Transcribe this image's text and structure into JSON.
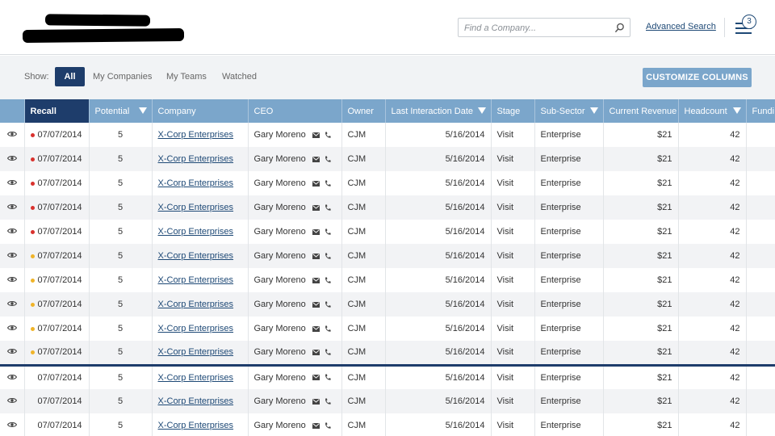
{
  "header": {
    "search_placeholder": "Find a Company...",
    "advanced_search_label": "Advanced Search",
    "menu_badge_count": "3"
  },
  "show_bar": {
    "label": "Show:",
    "filters": [
      "All",
      "My Companies",
      "My Teams",
      "Watched"
    ],
    "active_filter": "All",
    "customize_label": "CUSTOMIZE COLUMNS"
  },
  "table": {
    "columns": [
      "Recall",
      "Potential",
      "Company",
      "CEO",
      "Owner",
      "Last Interaction Date",
      "Stage",
      "Sub-Sector",
      "Current Revenue",
      "Headcount",
      "Fundi"
    ],
    "sorted_column": "Recall",
    "filter_columns": [
      "Potential",
      "Last Interaction Date",
      "Sub-Sector",
      "Headcount"
    ],
    "rows": [
      {
        "recall": "07/07/2014",
        "status": "red",
        "potential": "5",
        "company": "X-Corp Enterprises",
        "ceo": "Gary Moreno",
        "owner": "CJM",
        "last_interaction": "5/16/2014",
        "stage": "Visit",
        "sub_sector": "Enterprise",
        "revenue": "$21",
        "headcount": "42"
      },
      {
        "recall": "07/07/2014",
        "status": "red",
        "potential": "5",
        "company": "X-Corp Enterprises",
        "ceo": "Gary Moreno",
        "owner": "CJM",
        "last_interaction": "5/16/2014",
        "stage": "Visit",
        "sub_sector": "Enterprise",
        "revenue": "$21",
        "headcount": "42"
      },
      {
        "recall": "07/07/2014",
        "status": "red",
        "potential": "5",
        "company": "X-Corp Enterprises",
        "ceo": "Gary Moreno",
        "owner": "CJM",
        "last_interaction": "5/16/2014",
        "stage": "Visit",
        "sub_sector": "Enterprise",
        "revenue": "$21",
        "headcount": "42"
      },
      {
        "recall": "07/07/2014",
        "status": "red",
        "potential": "5",
        "company": "X-Corp Enterprises",
        "ceo": "Gary Moreno",
        "owner": "CJM",
        "last_interaction": "5/16/2014",
        "stage": "Visit",
        "sub_sector": "Enterprise",
        "revenue": "$21",
        "headcount": "42"
      },
      {
        "recall": "07/07/2014",
        "status": "red",
        "potential": "5",
        "company": "X-Corp Enterprises",
        "ceo": "Gary Moreno",
        "owner": "CJM",
        "last_interaction": "5/16/2014",
        "stage": "Visit",
        "sub_sector": "Enterprise",
        "revenue": "$21",
        "headcount": "42"
      },
      {
        "recall": "07/07/2014",
        "status": "yellow",
        "potential": "5",
        "company": "X-Corp Enterprises",
        "ceo": "Gary Moreno",
        "owner": "CJM",
        "last_interaction": "5/16/2014",
        "stage": "Visit",
        "sub_sector": "Enterprise",
        "revenue": "$21",
        "headcount": "42"
      },
      {
        "recall": "07/07/2014",
        "status": "yellow",
        "potential": "5",
        "company": "X-Corp Enterprises",
        "ceo": "Gary Moreno",
        "owner": "CJM",
        "last_interaction": "5/16/2014",
        "stage": "Visit",
        "sub_sector": "Enterprise",
        "revenue": "$21",
        "headcount": "42"
      },
      {
        "recall": "07/07/2014",
        "status": "yellow",
        "potential": "5",
        "company": "X-Corp Enterprises",
        "ceo": "Gary Moreno",
        "owner": "CJM",
        "last_interaction": "5/16/2014",
        "stage": "Visit",
        "sub_sector": "Enterprise",
        "revenue": "$21",
        "headcount": "42"
      },
      {
        "recall": "07/07/2014",
        "status": "yellow",
        "potential": "5",
        "company": "X-Corp Enterprises",
        "ceo": "Gary Moreno",
        "owner": "CJM",
        "last_interaction": "5/16/2014",
        "stage": "Visit",
        "sub_sector": "Enterprise",
        "revenue": "$21",
        "headcount": "42"
      },
      {
        "recall": "07/07/2014",
        "status": "yellow",
        "potential": "5",
        "company": "X-Corp Enterprises",
        "ceo": "Gary Moreno",
        "owner": "CJM",
        "last_interaction": "5/16/2014",
        "stage": "Visit",
        "sub_sector": "Enterprise",
        "revenue": "$21",
        "headcount": "42"
      },
      {
        "recall": "07/07/2014",
        "status": "none",
        "potential": "5",
        "company": "X-Corp Enterprises",
        "ceo": "Gary Moreno",
        "owner": "CJM",
        "last_interaction": "5/16/2014",
        "stage": "Visit",
        "sub_sector": "Enterprise",
        "revenue": "$21",
        "headcount": "42"
      },
      {
        "recall": "07/07/2014",
        "status": "none",
        "potential": "5",
        "company": "X-Corp Enterprises",
        "ceo": "Gary Moreno",
        "owner": "CJM",
        "last_interaction": "5/16/2014",
        "stage": "Visit",
        "sub_sector": "Enterprise",
        "revenue": "$21",
        "headcount": "42"
      },
      {
        "recall": "07/07/2014",
        "status": "none",
        "potential": "5",
        "company": "X-Corp Enterprises",
        "ceo": "Gary Moreno",
        "owner": "CJM",
        "last_interaction": "5/16/2014",
        "stage": "Visit",
        "sub_sector": "Enterprise",
        "revenue": "$21",
        "headcount": "42"
      }
    ]
  },
  "icons": {
    "row_view": "eye-icon",
    "search": "magnifier-icon",
    "menu": "hamburger-menu-icon",
    "ceo_email": "envelope-icon",
    "ceo_phone": "phone-icon"
  },
  "colors": {
    "navy": "#1e3d6b",
    "header_blue": "#7ba6cb",
    "status_red": "#d9322e",
    "status_yellow": "#f0b429"
  }
}
